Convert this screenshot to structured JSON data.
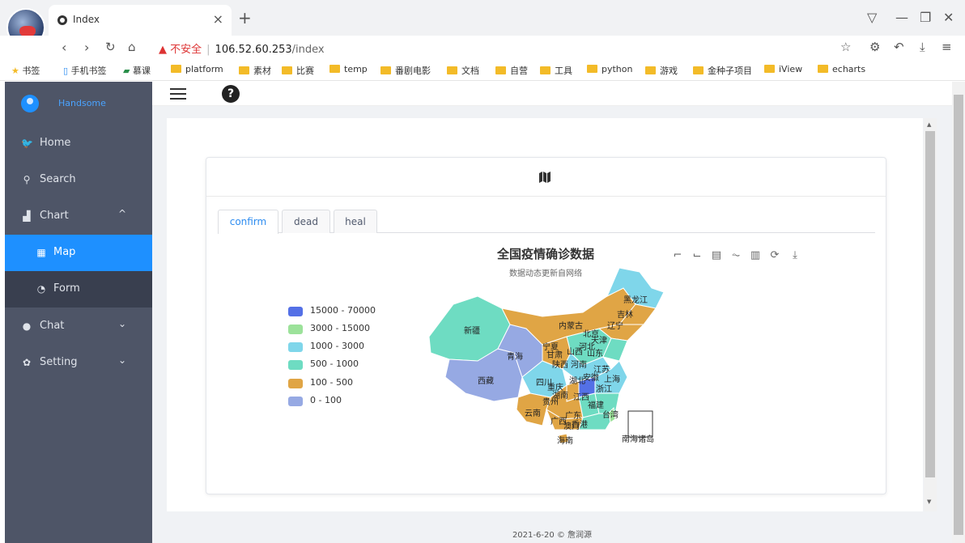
{
  "browser": {
    "tab_title": "Index",
    "close_glyph": "×",
    "new_tab_glyph": "+",
    "url_warning": "不安全",
    "url_separator": "|",
    "url_host": "106.52.60.253",
    "url_path": "/index"
  },
  "bookmarks": [
    {
      "label": "书签",
      "icon": "star-icon"
    },
    {
      "label": "手机书签",
      "icon": "phone-icon"
    },
    {
      "label": "慕课",
      "icon": "mooc-icon"
    },
    {
      "label": "platform",
      "icon": "folder-icon"
    },
    {
      "label": "素材",
      "icon": "folder-icon"
    },
    {
      "label": "比赛",
      "icon": "folder-icon"
    },
    {
      "label": "temp",
      "icon": "folder-icon"
    },
    {
      "label": "番剧电影",
      "icon": "folder-icon"
    },
    {
      "label": "文档",
      "icon": "folder-icon"
    },
    {
      "label": "自营",
      "icon": "folder-icon"
    },
    {
      "label": "工具",
      "icon": "folder-icon"
    },
    {
      "label": "python",
      "icon": "folder-icon"
    },
    {
      "label": "游戏",
      "icon": "folder-icon"
    },
    {
      "label": "金种子项目",
      "icon": "folder-icon"
    },
    {
      "label": "iView",
      "icon": "folder-icon"
    },
    {
      "label": "echarts",
      "icon": "folder-icon"
    }
  ],
  "sidebar": {
    "user_name": "Handsome",
    "items": [
      {
        "label": "Home",
        "icon": "bird-icon"
      },
      {
        "label": "Search",
        "icon": "search-icon"
      },
      {
        "label": "Chart",
        "icon": "bar-chart-icon",
        "chevron": "^"
      },
      {
        "label": "Map",
        "icon": "map-icon"
      },
      {
        "label": "Form",
        "icon": "pie-icon"
      },
      {
        "label": "Chat",
        "icon": "chat-icon",
        "chevron": "⌄"
      },
      {
        "label": "Setting",
        "icon": "gear-icon",
        "chevron": "⌄"
      }
    ]
  },
  "topbar": {
    "help_glyph": "?"
  },
  "tabs": [
    "confirm",
    "dead",
    "heal"
  ],
  "active_tab": "confirm",
  "chart": {
    "title": "全国疫情确诊数据",
    "subtitle": "数据动态更新自网络",
    "legend": [
      {
        "label": "15000 - 70000",
        "color": "#5470e6"
      },
      {
        "label": "3000 - 15000",
        "color": "#9ce29a"
      },
      {
        "label": "1000 - 3000",
        "color": "#7fd6ea"
      },
      {
        "label": "500 - 1000",
        "color": "#6edcc2"
      },
      {
        "label": "100 - 500",
        "color": "#e0a545"
      },
      {
        "label": "0 - 100",
        "color": "#96a9e3"
      }
    ],
    "provinces": [
      "黑龙江",
      "吉林",
      "辽宁",
      "内蒙古",
      "北京",
      "天津",
      "河北",
      "山西",
      "山东",
      "宁夏",
      "甘肃",
      "陕西",
      "河南",
      "新疆",
      "青海",
      "西藏",
      "四川",
      "湖北",
      "安徽",
      "上海",
      "江苏",
      "浙江",
      "重庆",
      "湖南",
      "江西",
      "贵州",
      "福建",
      "云南",
      "广西",
      "广东",
      "台湾",
      "香港",
      "澳门",
      "海南",
      "南海诸岛"
    ]
  },
  "footer": "2021-6-20 © 詹润源"
}
